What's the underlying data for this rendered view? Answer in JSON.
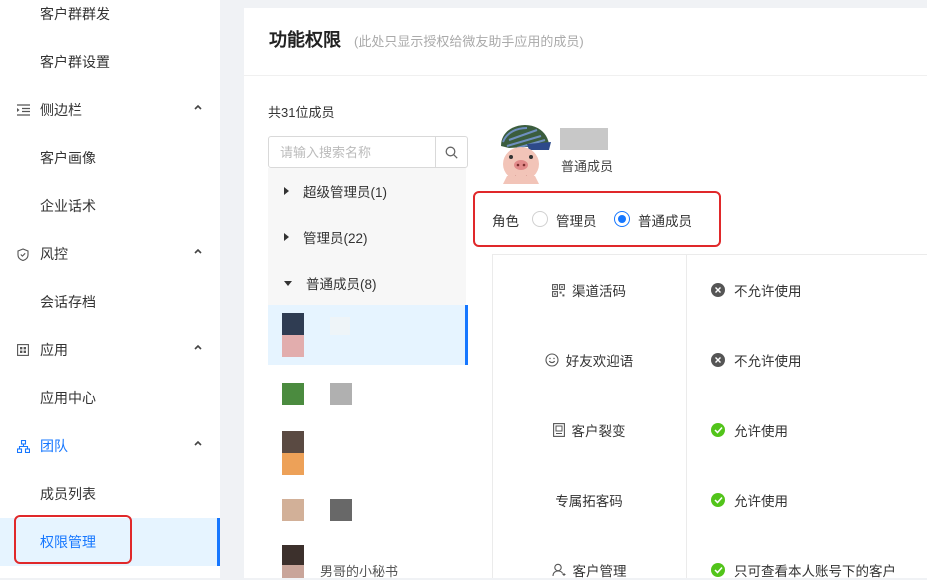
{
  "sidebar": {
    "items": [
      {
        "label": "客户群群发"
      },
      {
        "label": "客户群设置"
      },
      {
        "label": "侧边栏"
      },
      {
        "label": "客户画像"
      },
      {
        "label": "企业话术"
      },
      {
        "label": "风控"
      },
      {
        "label": "会话存档"
      },
      {
        "label": "应用"
      },
      {
        "label": "应用中心"
      },
      {
        "label": "团队"
      },
      {
        "label": "成员列表"
      },
      {
        "label": "权限管理"
      }
    ],
    "accent": "#1677ff"
  },
  "header": {
    "title": "功能权限",
    "note": "(此处只显示授权给微友助手应用的成员)"
  },
  "members": {
    "count": "共31位成员",
    "search_placeholder": "请输入搜索名称",
    "groups": [
      {
        "label": "超级管理员(1)"
      },
      {
        "label": "管理员(22)"
      },
      {
        "label": "普通成员(8)"
      }
    ],
    "partial_name": "男哥的小秘书"
  },
  "profile": {
    "role": "普通成员",
    "role_label": "角色",
    "options": [
      {
        "label": "管理员",
        "checked": false
      },
      {
        "label": "普通成员",
        "checked": true
      }
    ]
  },
  "permissions": [
    {
      "feature": "渠道活码",
      "icon": "qrcode-icon",
      "status": "不允许使用",
      "allowed": false
    },
    {
      "feature": "好友欢迎语",
      "icon": "smile-icon",
      "status": "不允许使用",
      "allowed": false
    },
    {
      "feature": "客户裂变",
      "icon": "poster-icon",
      "status": "允许使用",
      "allowed": true
    },
    {
      "feature": "专属拓客码",
      "icon": "",
      "status": "允许使用",
      "allowed": true
    },
    {
      "feature": "客户管理",
      "icon": "user-icon",
      "status": "只可查看本人账号下的客户",
      "allowed": true
    }
  ]
}
